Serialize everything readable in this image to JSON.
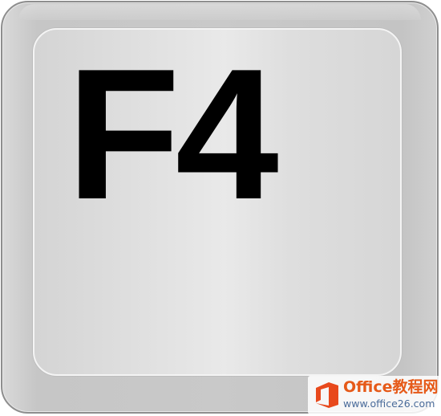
{
  "key": {
    "label": "F4"
  },
  "watermark": {
    "logo_icon": "office-logo-icon",
    "name": "Office教程网",
    "url": "www.office26.com",
    "colors": {
      "name": "#e65a19",
      "url": "#4a6b9a",
      "logo": "#e8491c"
    }
  },
  "colors": {
    "key_face": "#e3e3e3",
    "key_rim": "#c8c8c8",
    "key_border": "#8e8e8e",
    "label": "#000000"
  }
}
